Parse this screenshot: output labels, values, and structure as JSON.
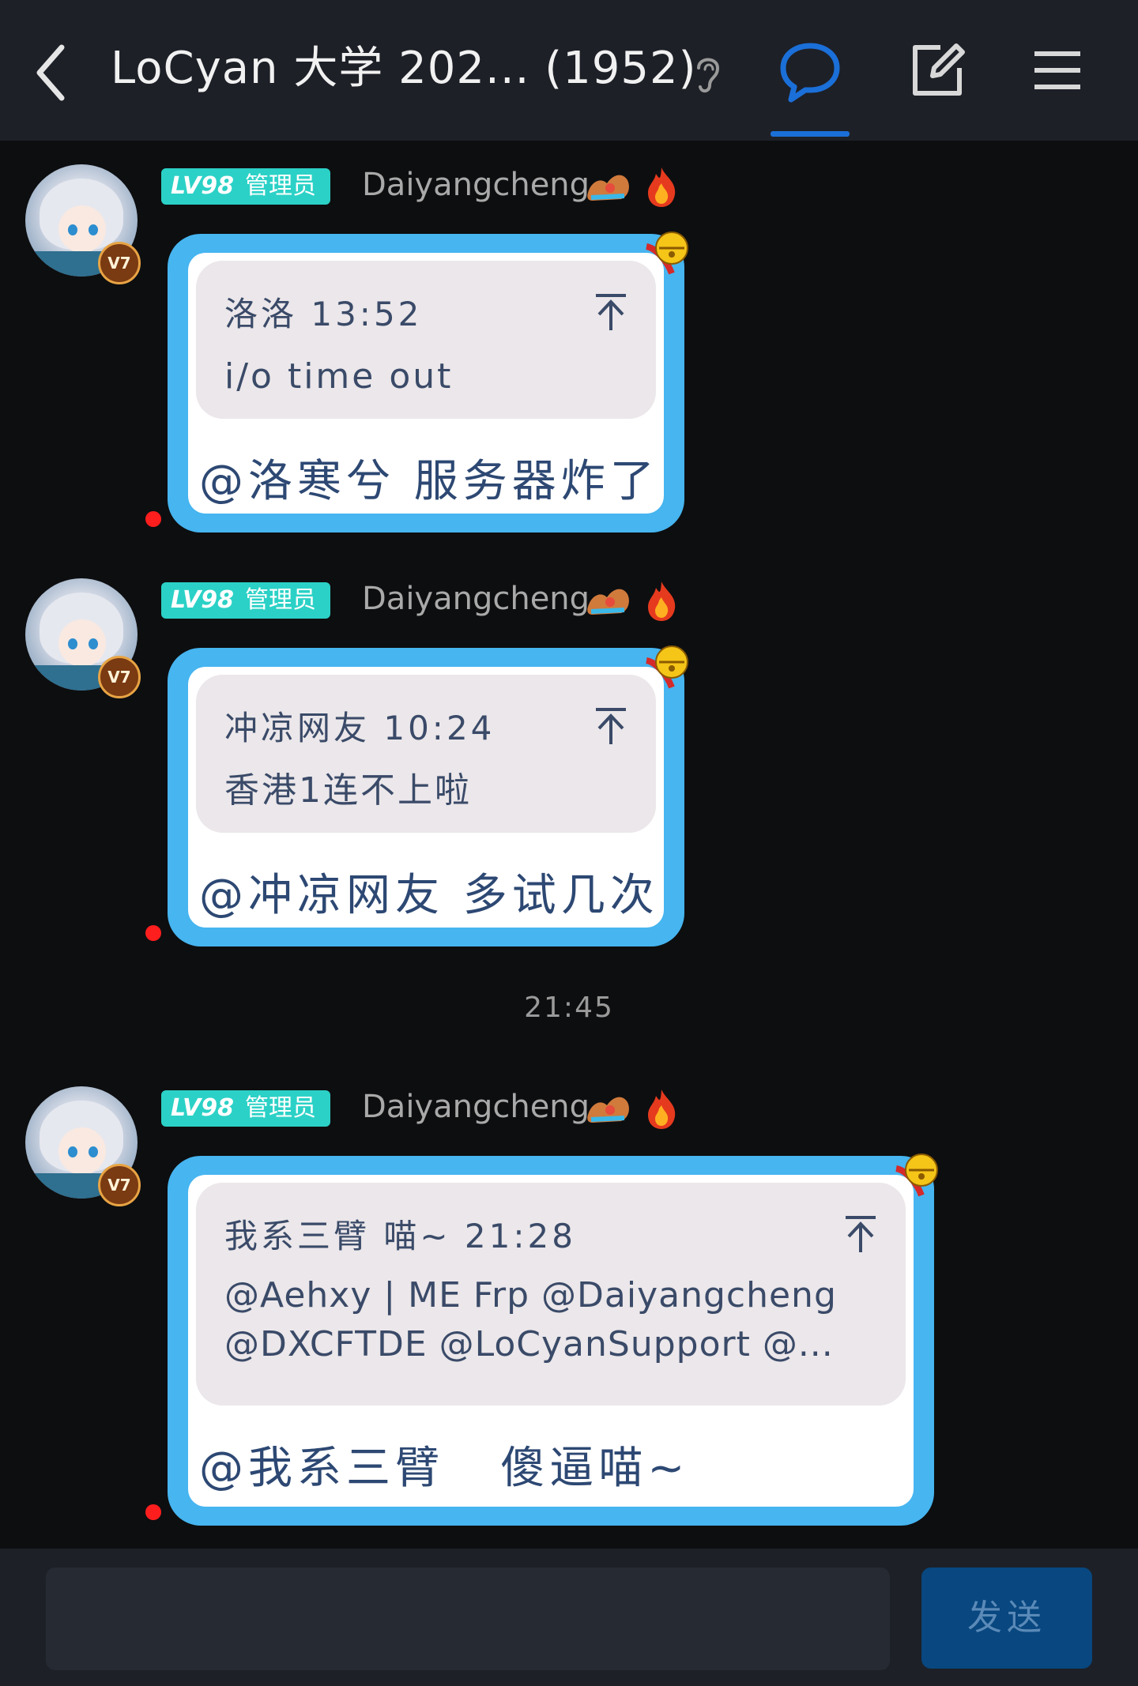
{
  "header": {
    "title": "LoCyan 大学 202... (1952)",
    "icons": [
      "back-icon",
      "ear-icon",
      "chat-icon",
      "edit-icon",
      "menu-icon"
    ],
    "accent_color": "#1b6fd8"
  },
  "messages": [
    {
      "level": "LV98",
      "role": "管理员",
      "username": "Daiyangcheng",
      "vip": "V7",
      "quote": {
        "meta": "洛洛 13:52",
        "text": "i/o time out"
      },
      "reply": "@洛寒兮 服务器炸了"
    },
    {
      "level": "LV98",
      "role": "管理员",
      "username": "Daiyangcheng",
      "vip": "V7",
      "quote": {
        "meta": "冲凉网友 10:24",
        "text": "香港1连不上啦"
      },
      "reply": "@冲凉网友 多试几次"
    },
    {
      "level": "LV98",
      "role": "管理员",
      "username": "Daiyangcheng",
      "vip": "V7",
      "quote": {
        "meta": "我系三臂  喵~ 21:28",
        "text_line1": "@Aehxy | ME Frp @Daiyangcheng",
        "text_line2": "@DXCFTDE @LoCyanSupport @..."
      },
      "reply": "@我系三臂   傻逼喵~"
    }
  ],
  "timestamp": "21:45",
  "composer": {
    "placeholder": "",
    "send_label": "发送"
  },
  "colors": {
    "bubble_border": "#46b5f0",
    "level_tag": "#2bd1c6",
    "send_button": "#08477f"
  }
}
